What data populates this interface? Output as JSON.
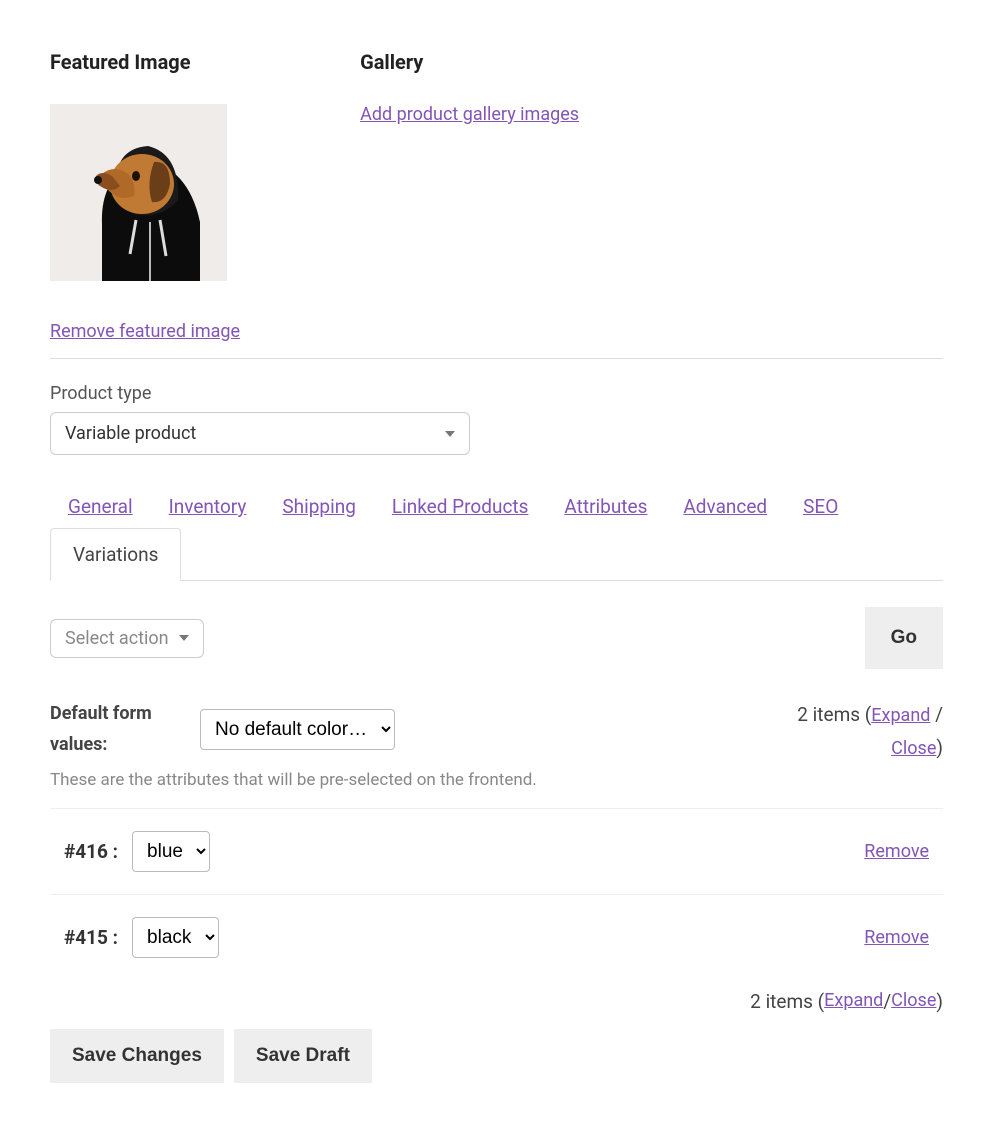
{
  "featured": {
    "heading": "Featured Image",
    "remove_link": "Remove featured image"
  },
  "gallery": {
    "heading": "Gallery",
    "add_link": "Add product gallery images"
  },
  "product_type": {
    "label": "Product type",
    "value": "Variable product"
  },
  "tabs": {
    "general": "General",
    "inventory": "Inventory",
    "shipping": "Shipping",
    "linked": "Linked Products",
    "attributes": "Attributes",
    "advanced": "Advanced",
    "seo": "SEO",
    "variations": "Variations"
  },
  "action_select": {
    "placeholder": "Select action",
    "go": "Go"
  },
  "defaults": {
    "label": "Default form values:",
    "select_value": "No default color…",
    "help": "These are the attributes that will be pre-selected on the frontend."
  },
  "summary": {
    "count_text": "2 items (",
    "expand": "Expand",
    "sep": " / ",
    "close": "Close",
    "end": ")"
  },
  "variations": [
    {
      "id_label": "#416 :",
      "value": "blue",
      "remove": "Remove"
    },
    {
      "id_label": "#415 :",
      "value": "black",
      "remove": "Remove"
    }
  ],
  "buttons": {
    "save_changes": "Save Changes",
    "save_draft": "Save Draft"
  }
}
